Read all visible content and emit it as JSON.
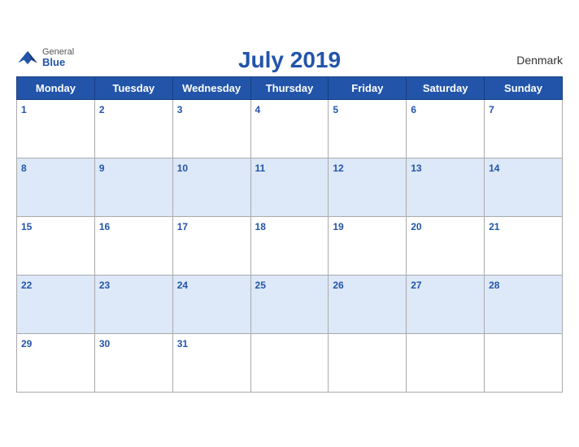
{
  "header": {
    "title": "July 2019",
    "country": "Denmark",
    "logo": {
      "general": "General",
      "blue": "Blue"
    }
  },
  "days_of_week": [
    "Monday",
    "Tuesday",
    "Wednesday",
    "Thursday",
    "Friday",
    "Saturday",
    "Sunday"
  ],
  "weeks": [
    [
      1,
      2,
      3,
      4,
      5,
      6,
      7
    ],
    [
      8,
      9,
      10,
      11,
      12,
      13,
      14
    ],
    [
      15,
      16,
      17,
      18,
      19,
      20,
      21
    ],
    [
      22,
      23,
      24,
      25,
      26,
      27,
      28
    ],
    [
      29,
      30,
      31,
      null,
      null,
      null,
      null
    ]
  ]
}
